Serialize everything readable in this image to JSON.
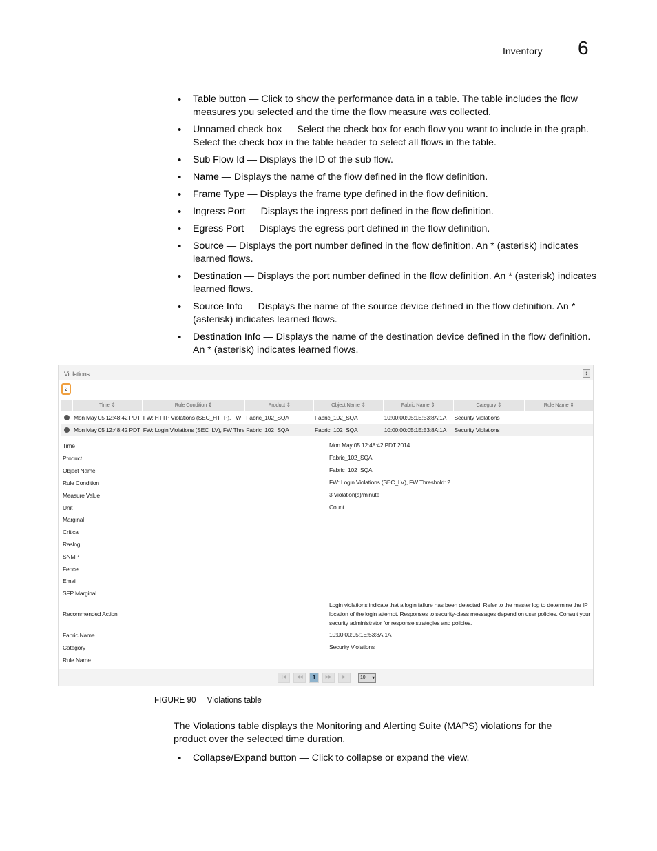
{
  "header": {
    "section": "Inventory",
    "chapter": "6"
  },
  "bullets": [
    {
      "term": "Table",
      "text": " button — Click to show the performance data in a table. The table includes the flow measures you selected and the time the flow measure was collected."
    },
    {
      "term": "",
      "text": "Unnamed check box — Select the check box for each flow you want to include in the graph. Select the check box in the table header to select all flows in the table."
    },
    {
      "term": "Sub Flow Id",
      "text": " — Displays the ID of the sub flow."
    },
    {
      "term": "Name",
      "text": " — Displays the name of the flow defined in the flow definition."
    },
    {
      "term": "Frame Type",
      "text": " — Displays the frame type defined in the flow definition."
    },
    {
      "term": "Ingress Port",
      "text": " — Displays the ingress port defined in the flow definition."
    },
    {
      "term": "Egress Port",
      "text": " — Displays the egress port defined in the flow definition."
    },
    {
      "term": "Source",
      "text": " — Displays the port number defined in the flow definition. An * (asterisk) indicates learned flows."
    },
    {
      "term": "Destination",
      "text": " — Displays the port number defined in the flow definition. An * (asterisk) indicates learned flows."
    },
    {
      "term": "Source Info",
      "text": " — Displays the name of the source device defined in the flow definition. An * (asterisk) indicates learned flows."
    },
    {
      "term": "Destination Info",
      "text": " — Displays the name of the destination device defined in the flow definition. An * (asterisk) indicates learned flows."
    }
  ],
  "screenshot": {
    "title": "Violations",
    "count": "2",
    "columns": [
      "Time ⇕",
      "Rule Condition ⇕",
      "Product ⇕",
      "Object Name ⇕",
      "Fabric Name ⇕",
      "Category ⇕",
      "Rule Name ⇕"
    ],
    "rows": [
      [
        "Mon May 05 12:48:42 PDT 2",
        "FW: HTTP Violations (SEC_HTTP), FW T",
        "Fabric_102_SQA",
        "Fabric_102_SQA",
        "10:00:00:05:1E:53:8A:1A",
        "Security Violations",
        ""
      ],
      [
        "Mon May 05 12:48:42 PDT 2",
        "FW: Login Violations (SEC_LV), FW Thre",
        "Fabric_102_SQA",
        "Fabric_102_SQA",
        "10:00:00:05:1E:53:8A:1A",
        "Security Violations",
        ""
      ]
    ],
    "details": [
      {
        "label": "Time",
        "value": "Mon May 05 12:48:42 PDT 2014"
      },
      {
        "label": "Product",
        "value": "Fabric_102_SQA"
      },
      {
        "label": "Object Name",
        "value": "Fabric_102_SQA"
      },
      {
        "label": "Rule Condition",
        "value": "FW: Login Violations (SEC_LV), FW Threshold: 2"
      },
      {
        "label": "Measure Value",
        "value": "3 Violation(s)/minute"
      },
      {
        "label": "Unit",
        "value": "Count"
      },
      {
        "label": "Marginal",
        "value": ""
      },
      {
        "label": "Critical",
        "value": ""
      },
      {
        "label": "Raslog",
        "value": ""
      },
      {
        "label": "SNMP",
        "value": ""
      },
      {
        "label": "Fence",
        "value": ""
      },
      {
        "label": "Email",
        "value": ""
      },
      {
        "label": "SFP Marginal",
        "value": ""
      },
      {
        "label": "Recommended Action",
        "value": " Login violations indicate that a login failure has been detected. Refer to the master log to determine the IP location of the login attempt. Responses to security-class messages depend on user policies. Consult your security administrator for response strategies and policies."
      },
      {
        "label": "Fabric Name",
        "value": "10:00:00:05:1E:53:8A:1A"
      },
      {
        "label": "Category",
        "value": "Security Violations"
      },
      {
        "label": "Rule Name",
        "value": ""
      }
    ],
    "pager": {
      "first": "|◀",
      "prev": "◀◀",
      "page": "1",
      "next": "▶▶",
      "last": "▶|",
      "page_size": "10"
    }
  },
  "caption": {
    "label": "FIGURE 90",
    "title": "Violations table"
  },
  "paragraph": {
    "pre": "The ",
    "term": "Violations",
    "post": " table displays the Monitoring and Alerting Suite (MAPS) violations for the product over the selected time duration."
  },
  "bullets2": [
    {
      "term": "Collapse/Expand",
      "text": " button — Click to collapse or expand the view."
    }
  ]
}
